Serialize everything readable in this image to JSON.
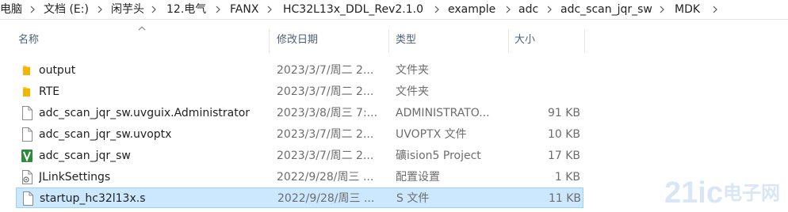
{
  "breadcrumb": [
    "电脑",
    "文档 (E:)",
    "闲芋头",
    "12.电气",
    "FANX",
    "HC32L13x_DDL_Rev2.1.0",
    "example",
    "adc",
    "adc_scan_jqr_sw",
    "MDK"
  ],
  "columns": {
    "name": "名称",
    "date": "修改日期",
    "type": "类型",
    "size": "大小"
  },
  "files": [
    {
      "name": "output",
      "date": "2023/3/7/周二 2...",
      "type": "文件夹",
      "size": "",
      "icon": "folder-icon"
    },
    {
      "name": "RTE",
      "date": "2023/3/7/周二 2...",
      "type": "文件夹",
      "size": "",
      "icon": "folder-icon"
    },
    {
      "name": "adc_scan_jqr_sw.uvguix.Administrator",
      "date": "2023/3/8/周三 7:...",
      "type": "ADMINISTRATO...",
      "size": "91 KB",
      "icon": "file-icon"
    },
    {
      "name": "adc_scan_jqr_sw.uvoptx",
      "date": "2023/3/7/周二 2...",
      "type": "UVOPTX 文件",
      "size": "10 KB",
      "icon": "file-icon"
    },
    {
      "name": "adc_scan_jqr_sw",
      "date": "2023/3/7/周二 2...",
      "type": "礦ision5 Project",
      "size": "17 KB",
      "icon": "keil-project-icon"
    },
    {
      "name": "JLinkSettings",
      "date": "2022/9/28/周三 ...",
      "type": "配置设置",
      "size": "1 KB",
      "icon": "settings-file-icon"
    },
    {
      "name": "startup_hc32l13x.s",
      "date": "2022/9/28/周三 ...",
      "type": "S 文件",
      "size": "11 KB",
      "icon": "file-icon",
      "selected": true
    }
  ],
  "watermark": {
    "brand": "21ic",
    "text": "电子网"
  },
  "colors": {
    "selection_bg": "#cce8ff",
    "selection_border": "#99d1ff",
    "folder": "#ffc83d",
    "keil_green": "#2e8b3a"
  }
}
